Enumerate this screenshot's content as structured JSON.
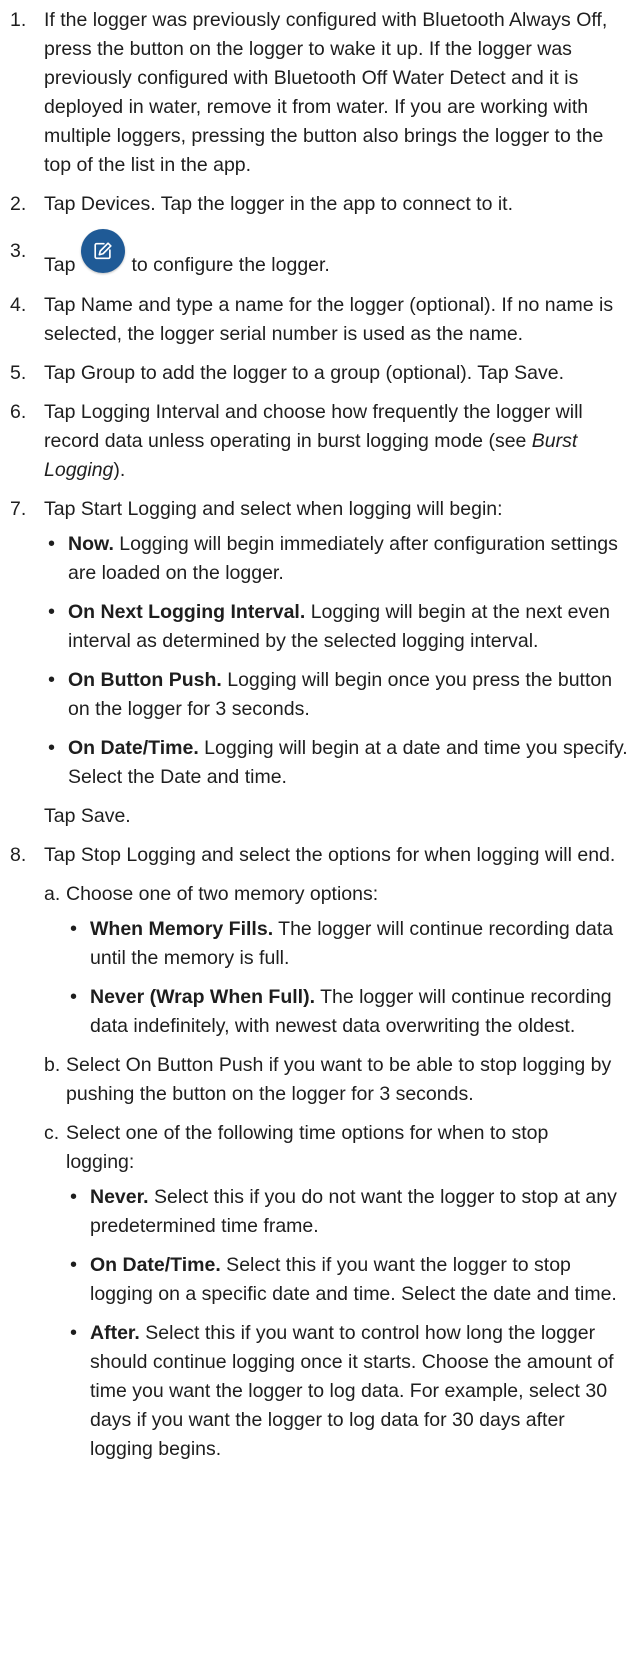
{
  "steps": [
    {
      "num": "1.",
      "text": "If the logger was previously configured with Bluetooth Always Off, press the button on the logger to wake it up. If the logger was previously configured with Bluetooth Off Water Detect and it is deployed in water, remove it from water. If you are working with multiple loggers, pressing the button also brings the logger to the top of the list in the app."
    },
    {
      "num": "2.",
      "text": "Tap Devices. Tap the logger in the app to connect to it."
    },
    {
      "num": "3.",
      "pre": "Tap",
      "post": "to configure the logger.",
      "icon": "edit-pencil-icon"
    },
    {
      "num": "4.",
      "text": "Tap Name and type a name for the logger (optional). If no name is selected, the logger serial number is used as the name."
    },
    {
      "num": "5.",
      "text": "Tap Group to add the logger to a group (optional). Tap Save."
    },
    {
      "num": "6.",
      "pre": "Tap Logging Interval and choose how frequently the logger will record data unless operating in burst logging mode (see ",
      "link": "Burst Logging",
      "post": ")."
    },
    {
      "num": "7.",
      "text": "Tap Start Logging and select when logging will begin:",
      "bullets": [
        {
          "bold": "Now.",
          "text": " Logging will begin immediately after configuration settings are loaded on the logger."
        },
        {
          "bold": "On Next Logging Interval.",
          "text": " Logging will begin at the next even interval as determined by the selected logging interval."
        },
        {
          "bold": "On Button Push.",
          "text": " Logging will begin once you press the button on the logger for 3 seconds."
        },
        {
          "bold": "On Date/Time.",
          "text": " Logging will begin at a date and time you specify. Select the Date and time."
        }
      ],
      "after": "Tap Save."
    },
    {
      "num": "8.",
      "text": "Tap Stop Logging and select the options for when logging will end.",
      "subs": [
        {
          "letter": "a.",
          "text": "Choose one of two memory options:",
          "bullets": [
            {
              "bold": "When Memory Fills.",
              "text": " The logger will continue recording data until the memory is full."
            },
            {
              "bold": "Never (Wrap When Full).",
              "text": " The logger will continue recording data indefinitely, with newest data overwriting the oldest."
            }
          ]
        },
        {
          "letter": "b.",
          "text": "Select On Button Push if you want to be able to stop logging by pushing the button on the logger for 3 seconds."
        },
        {
          "letter": "c.",
          "text": "Select one of the following time options for when to stop logging:",
          "bullets": [
            {
              "bold": "Never.",
              "text": " Select this if you do not want the logger to stop at any predetermined time frame."
            },
            {
              "bold": "On Date/Time.",
              "text": " Select this if you want the logger to stop logging on a specific date and time. Select the date and time."
            },
            {
              "bold": "After.",
              "text": " Select this if you want to control how long the logger should continue logging once it starts. Choose the amount of time you want the logger to log data. For example, select 30 days if you want the logger to log data for 30 days after logging begins."
            }
          ]
        }
      ]
    }
  ],
  "colors": {
    "button": "#1f5a96",
    "text": "#1e1e1e"
  }
}
